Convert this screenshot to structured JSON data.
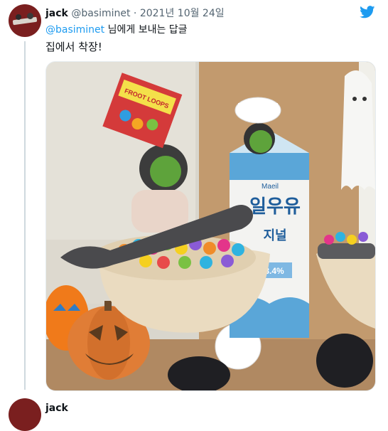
{
  "tweet": {
    "name": "jack",
    "handle": "@basiminet",
    "separator": "·",
    "date": "2021년 10월 24일",
    "reply_handle": "@basiminet",
    "reply_text": "님에게 보내는 답글",
    "body": "집에서 착장!"
  },
  "photo": {
    "cereal_box_text": "FROOT LOOPS",
    "milk_brand": "Maeil",
    "milk_label": "일우유",
    "milk_sub": "지널",
    "milk_pct": "3.4%"
  },
  "next_tweet": {
    "name": "jack"
  },
  "colors": {
    "twitter_blue": "#1d9bf0",
    "text_primary": "#0f1419",
    "text_secondary": "#536471",
    "thread_line": "#cfd9de"
  },
  "icons": [
    "twitter-bird-icon"
  ]
}
